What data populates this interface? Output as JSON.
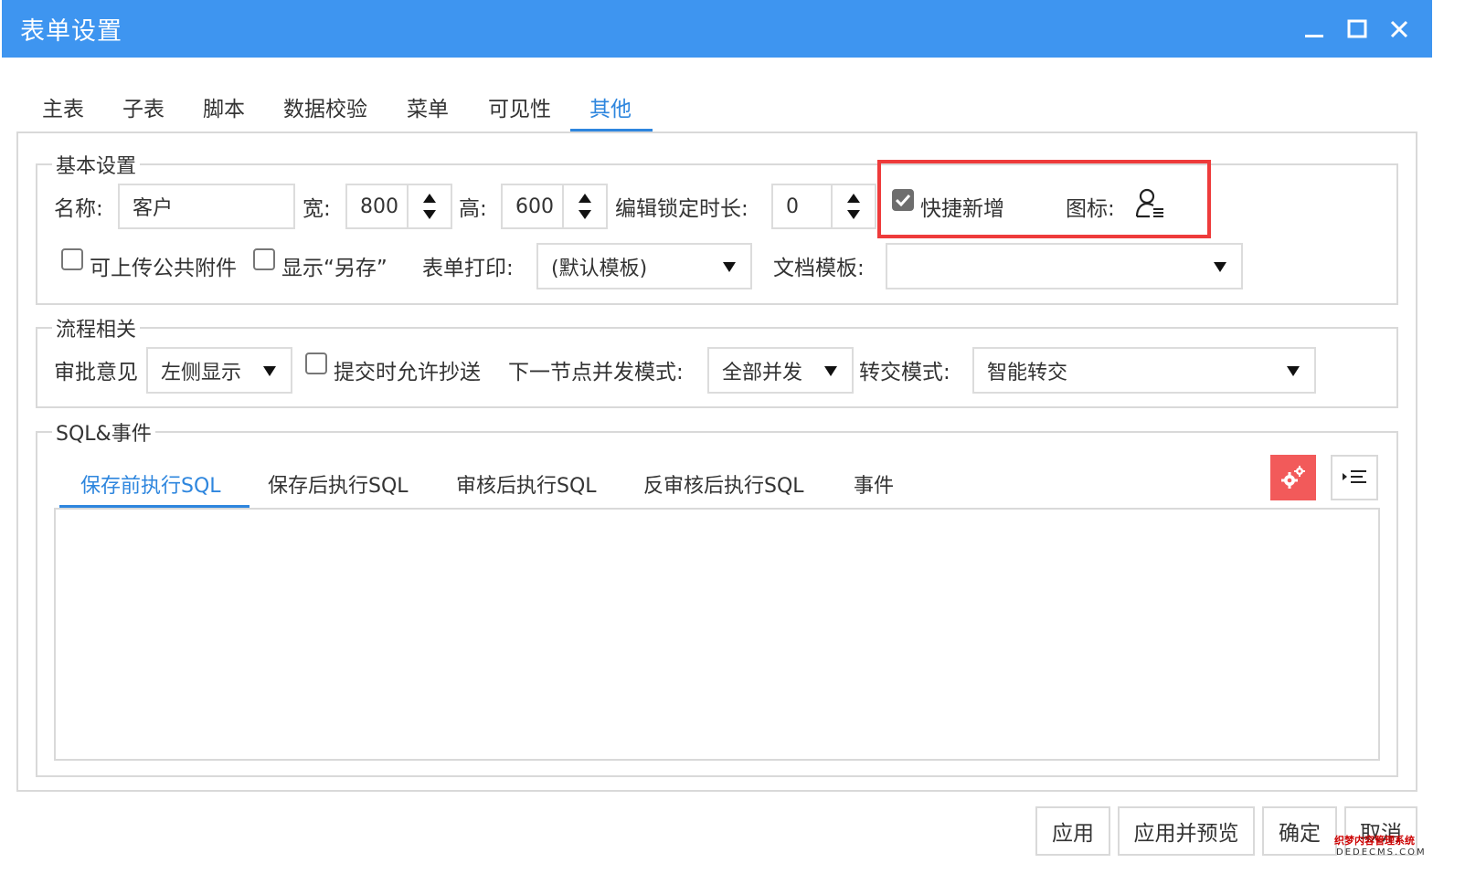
{
  "window": {
    "title": "表单设置",
    "controls": [
      "minimize-icon",
      "maximize-icon",
      "close-icon"
    ]
  },
  "tabs": [
    {
      "label": "主表"
    },
    {
      "label": "子表"
    },
    {
      "label": "脚本"
    },
    {
      "label": "数据校验"
    },
    {
      "label": "菜单"
    },
    {
      "label": "可见性"
    },
    {
      "label": "其他",
      "active": true
    }
  ],
  "basic": {
    "legend": "基本设置",
    "name_label": "名称:",
    "name_value": "客户",
    "width_label": "宽:",
    "width_value": "800",
    "height_label": "高:",
    "height_value": "600",
    "lock_label": "编辑锁定时长:",
    "lock_value": "0",
    "quick_add_label": "快捷新增",
    "quick_add_checked": true,
    "icon_label": "图标:",
    "icon_name": "user-list-icon",
    "upload_label": "可上传公共附件",
    "saveas_label": "显示“另存”",
    "print_label": "表单打印:",
    "print_value": "(默认模板)",
    "doc_label": "文档模板:",
    "doc_value": ""
  },
  "flow": {
    "legend": "流程相关",
    "opinion_label": "审批意见",
    "opinion_value": "左侧显示",
    "cc_label": "提交时允许抄送",
    "next_label": "下一节点并发模式:",
    "next_value": "全部并发",
    "transfer_label": "转交模式:",
    "transfer_value": "智能转交"
  },
  "sql": {
    "legend": "SQL&事件",
    "tabs": [
      {
        "label": "保存前执行SQL",
        "active": true
      },
      {
        "label": "保存后执行SQL"
      },
      {
        "label": "审核后执行SQL"
      },
      {
        "label": "反审核后执行SQL"
      },
      {
        "label": "事件"
      }
    ],
    "editor_value": ""
  },
  "footer": {
    "apply": "应用",
    "apply_preview": "应用并预览",
    "ok": "确定",
    "cancel": "取消"
  },
  "watermark": {
    "line1": "织梦内容管理系统",
    "line2": "DEDECMS.COM"
  },
  "colors": {
    "title_bar": "#3e95f0",
    "accent": "#2e86de",
    "highlight": "#ee3b3b",
    "settings_button": "#f25a5a"
  }
}
